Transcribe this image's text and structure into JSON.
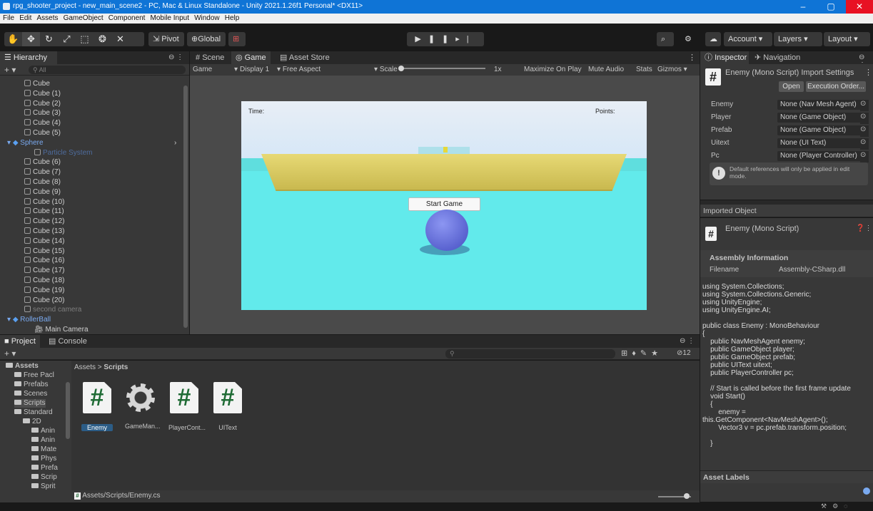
{
  "window": {
    "title": "rpg_shooter_project - new_main_scene2 - PC, Mac & Linux Standalone - Unity 2021.1.26f1 Personal* <DX11>",
    "minimize": "–",
    "maximize": "▢",
    "close": "✕"
  },
  "menu": [
    "File",
    "Edit",
    "Assets",
    "GameObject",
    "Component",
    "Mobile Input",
    "Window",
    "Help"
  ],
  "toolbar": {
    "pivot_label": "Pivot",
    "global_label": "Global",
    "account_label": "Account",
    "layers_label": "Layers",
    "layout_label": "Layout"
  },
  "hierarchy": {
    "tab": "Hierarchy",
    "search_placeholder": "All",
    "items": [
      {
        "label": "Cube",
        "type": "cube",
        "indent": 2
      },
      {
        "label": "Cube (1)",
        "type": "cube",
        "indent": 2
      },
      {
        "label": "Cube (2)",
        "type": "cube",
        "indent": 2
      },
      {
        "label": "Cube (3)",
        "type": "cube",
        "indent": 2
      },
      {
        "label": "Cube (4)",
        "type": "cube",
        "indent": 2
      },
      {
        "label": "Cube (5)",
        "type": "cube",
        "indent": 2
      },
      {
        "label": "Sphere",
        "type": "prefab",
        "indent": 1
      },
      {
        "label": "Particle System",
        "type": "dim-blue",
        "indent": 3
      },
      {
        "label": "Cube (6)",
        "type": "cube",
        "indent": 2
      },
      {
        "label": "Cube (7)",
        "type": "cube",
        "indent": 2
      },
      {
        "label": "Cube (8)",
        "type": "cube",
        "indent": 2
      },
      {
        "label": "Cube (9)",
        "type": "cube",
        "indent": 2
      },
      {
        "label": "Cube (10)",
        "type": "cube",
        "indent": 2
      },
      {
        "label": "Cube (11)",
        "type": "cube",
        "indent": 2
      },
      {
        "label": "Cube (12)",
        "type": "cube",
        "indent": 2
      },
      {
        "label": "Cube (13)",
        "type": "cube",
        "indent": 2
      },
      {
        "label": "Cube (14)",
        "type": "cube",
        "indent": 2
      },
      {
        "label": "Cube (15)",
        "type": "cube",
        "indent": 2
      },
      {
        "label": "Cube (16)",
        "type": "cube",
        "indent": 2
      },
      {
        "label": "Cube (17)",
        "type": "cube",
        "indent": 2
      },
      {
        "label": "Cube (18)",
        "type": "cube",
        "indent": 2
      },
      {
        "label": "Cube (19)",
        "type": "cube",
        "indent": 2
      },
      {
        "label": "Cube (20)",
        "type": "cube",
        "indent": 2
      },
      {
        "label": "second camera",
        "type": "dim",
        "indent": 2
      },
      {
        "label": "RollerBall",
        "type": "prefab",
        "indent": 1
      },
      {
        "label": "Main Camera",
        "type": "camera",
        "indent": 3
      }
    ]
  },
  "scene_tabs": {
    "scene": "Scene",
    "game": "Game",
    "asset_store": "Asset Store"
  },
  "game_toolbar": {
    "game": "Game",
    "display": "Display 1",
    "aspect": "Free Aspect",
    "scale_label": "Scale",
    "scale_value": "1x",
    "maximize": "Maximize On Play",
    "mute": "Mute Audio",
    "stats": "Stats",
    "gizmos": "Gizmos"
  },
  "game_view": {
    "time_label": "Time:",
    "points_label": "Points:",
    "start_button": "Start Game"
  },
  "inspector": {
    "tab_inspector": "Inspector",
    "tab_navigation": "Navigation",
    "header_title": "Enemy (Mono Script) Import Settings",
    "open_button": "Open",
    "exec_order_button": "Execution Order...",
    "fields": [
      {
        "label": "Enemy",
        "value": "None (Nav Mesh Agent)"
      },
      {
        "label": "Player",
        "value": "None (Game Object)"
      },
      {
        "label": "Prefab",
        "value": "None (Game Object)"
      },
      {
        "label": "Uitext",
        "value": "None (UI Text)"
      },
      {
        "label": "Pc",
        "value": "None (Player Controller)"
      }
    ],
    "info_text": "Default references will only be applied in edit mode.",
    "imported_object": "Imported Object",
    "script_title": "Enemy (Mono Script)",
    "assembly_header": "Assembly Information",
    "filename_label": "Filename",
    "filename_value": "Assembly-CSharp.dll",
    "code": "using System.Collections;\nusing System.Collections.Generic;\nusing UnityEngine;\nusing UnityEngine.AI;\n\npublic class Enemy : MonoBehaviour\n{\n    public NavMeshAgent enemy;\n    public GameObject player;\n    public GameObject prefab;\n    public UIText uitext;\n    public PlayerController pc;\n\n    // Start is called before the first frame update\n    void Start()\n    {\n        enemy =\nthis.GetComponent<NavMeshAgent>();\n        Vector3 v = pc.prefab.transform.position;\n\n    }",
    "asset_labels": "Asset Labels"
  },
  "project": {
    "tab_project": "Project",
    "tab_console": "Console",
    "breadcrumb_root": "Assets",
    "breadcrumb_current": "Scripts",
    "hidden_count": "12",
    "folders": [
      {
        "label": "Assets",
        "indent": 0
      },
      {
        "label": "Free Pacl",
        "indent": 1
      },
      {
        "label": "Prefabs",
        "indent": 1
      },
      {
        "label": "Scenes",
        "indent": 1
      },
      {
        "label": "Scripts",
        "indent": 1
      },
      {
        "label": "Standard",
        "indent": 1
      },
      {
        "label": "2D",
        "indent": 2
      },
      {
        "label": "Anin",
        "indent": 3
      },
      {
        "label": "Anin",
        "indent": 3
      },
      {
        "label": "Mate",
        "indent": 3
      },
      {
        "label": "Phys",
        "indent": 3
      },
      {
        "label": "Prefa",
        "indent": 3
      },
      {
        "label": "Scrip",
        "indent": 3
      },
      {
        "label": "Sprit",
        "indent": 3
      }
    ],
    "assets": [
      {
        "label": "Enemy",
        "kind": "script"
      },
      {
        "label": "GameMan...",
        "kind": "gear"
      },
      {
        "label": "PlayerCont...",
        "kind": "script"
      },
      {
        "label": "UIText",
        "kind": "script"
      }
    ],
    "footer_path": "Assets/Scripts/Enemy.cs"
  }
}
